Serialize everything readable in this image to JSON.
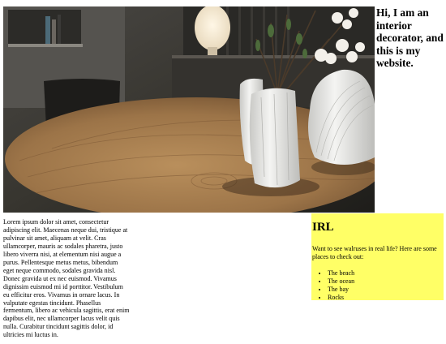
{
  "hero": {
    "heading": "Hi, I am an interior decorator, and this is my website.",
    "image_alt": "Round wooden dining table with white ceramic vases and cotton branches"
  },
  "main": {
    "paragraph": "Lorem ipsum dolor sit amet, consectetur adipiscing elit. Maecenas neque dui, tristique at pulvinar sit amet, aliquam at velit. Cras ullamcorper, mauris ac sodales pharetra, justo libero viverra nisi, at elementum nisi augue a purus. Pellentesque metus metus, bibendum eget neque commodo, sodales gravida nisl. Donec gravida ut ex nec euismod. Vivamus dignissim euismod mi id porttitor. Vestibulum eu efficitur eros. Vivamus in ornare lacus. In vulputate egestas tincidunt. Phasellus fermentum, libero ac vehicula sagittis, erat enim dapibus elit, nec ullamcorper lacus velit quis nulla. Curabitur tincidunt sagittis dolor, id ultricies mi luctus in."
  },
  "aside": {
    "title": "IRL",
    "intro": "Want to see walruses in real life? Here are some places to check out:",
    "places": [
      "The beach",
      "The ocean",
      "The bay",
      "Rocks"
    ],
    "background_color": "#ffff66"
  },
  "icons": {
    "photo": "interior-photo"
  }
}
